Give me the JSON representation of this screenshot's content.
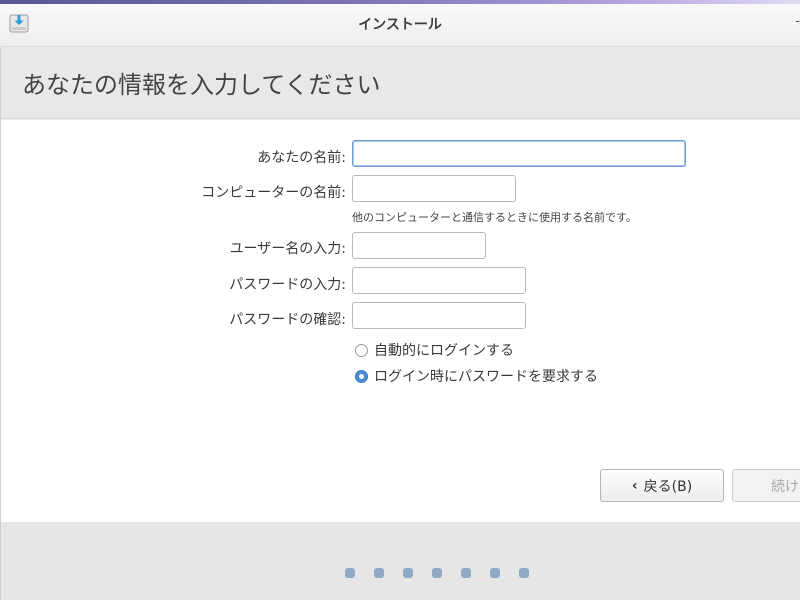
{
  "window": {
    "title": "インストール",
    "edge_glyph": "-"
  },
  "header": {
    "heading": "あなたの情報を入力してください"
  },
  "form": {
    "name_label": "あなたの名前:",
    "name_value": "",
    "computer_label": "コンピューターの名前:",
    "computer_value": "",
    "computer_hint": "他のコンピューターと通信するときに使用する名前です。",
    "username_label": "ユーザー名の入力:",
    "username_value": "",
    "password_label": "パスワードの入力:",
    "password_value": "",
    "confirm_label": "パスワードの確認:",
    "confirm_value": "",
    "login_options": [
      {
        "label": "自動的にログインする",
        "selected": false
      },
      {
        "label": "ログイン時にパスワードを要求する",
        "selected": true
      }
    ]
  },
  "buttons": {
    "back_label": "戻る(B)",
    "next_label": "続け"
  },
  "progress": {
    "dots": 7
  },
  "colors": {
    "accent": "#4a8ad6",
    "dot": "#8fa9c6"
  }
}
